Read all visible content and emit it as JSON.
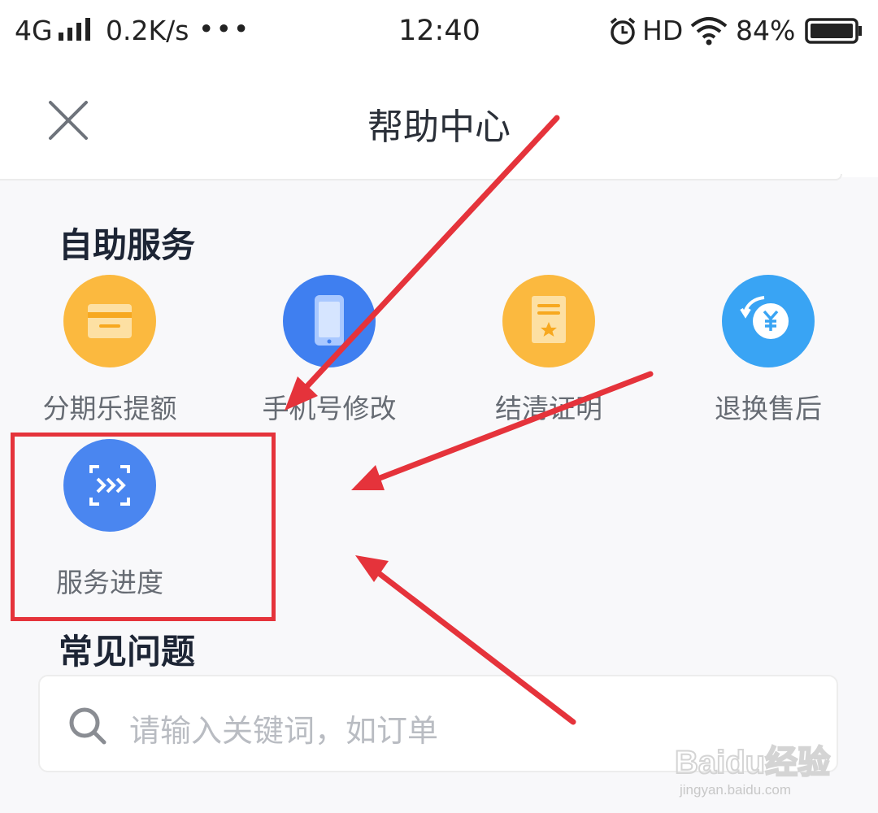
{
  "status_bar": {
    "network": "4G",
    "speed": "0.2K/s",
    "more": "•••",
    "time": "12:40",
    "hd": "HD",
    "battery": "84%"
  },
  "header": {
    "title": "帮助中心",
    "close_icon": "close-icon"
  },
  "self_service": {
    "title": "自助服务",
    "items": [
      {
        "label": "分期乐提额",
        "icon": "credit-card-icon",
        "color": "#fbb93f"
      },
      {
        "label": "手机号修改",
        "icon": "phone-icon",
        "color": "#3f7ff0"
      },
      {
        "label": "结清证明",
        "icon": "certificate-icon",
        "color": "#fbb93f"
      },
      {
        "label": "退换售后",
        "icon": "refund-yuan-icon",
        "color": "#39a4f4"
      },
      {
        "label": "服务进度",
        "icon": "progress-icon",
        "color": "#4a86f0"
      }
    ]
  },
  "faq": {
    "title": "常见问题",
    "search_placeholder": "请输入关键词，如订单"
  },
  "annotation": {
    "highlight_color": "#e5333b"
  },
  "watermark": {
    "brand": "Baidu经验",
    "url": "jingyan.baidu.com"
  }
}
